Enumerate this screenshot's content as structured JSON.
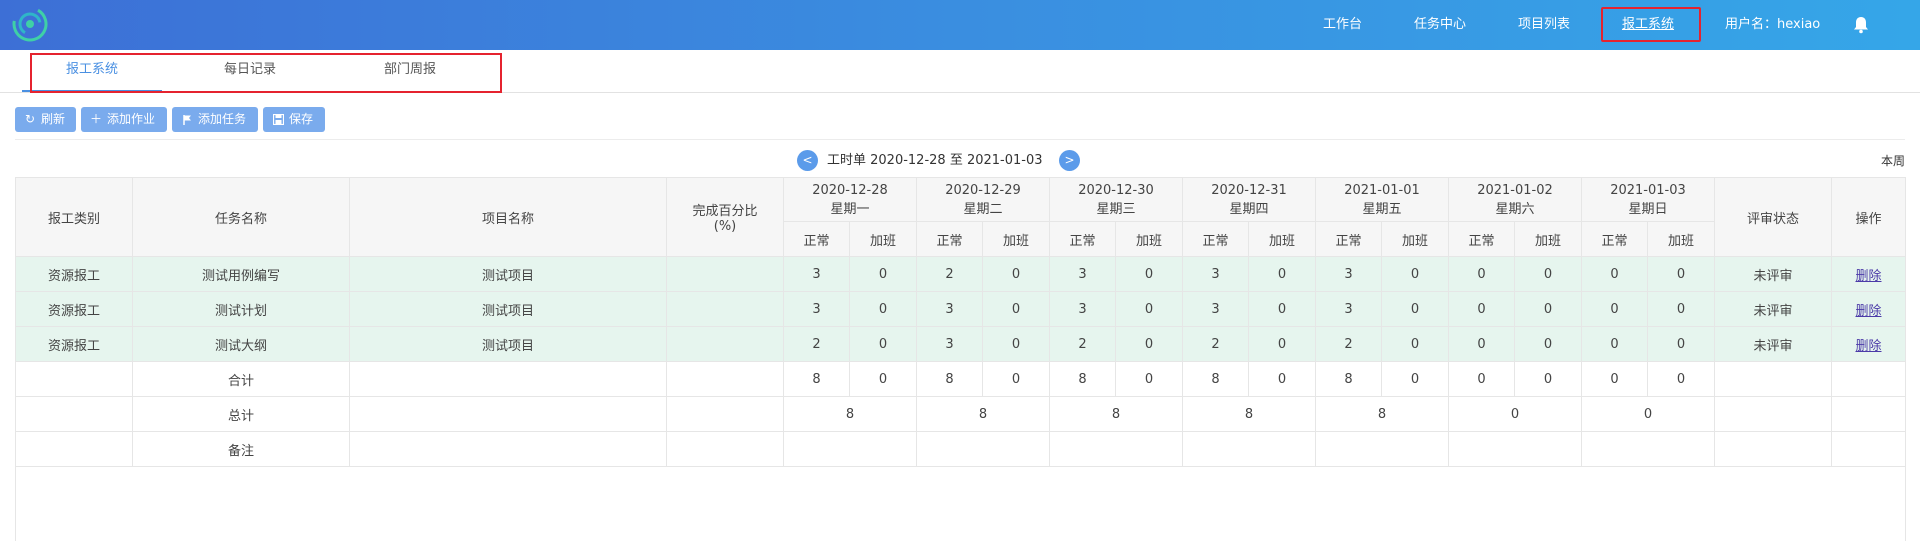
{
  "nav": {
    "items": [
      "工作台",
      "任务中心",
      "项目列表",
      "报工系统"
    ],
    "active_index": 3,
    "user_label": "用户名：hexiao"
  },
  "subtabs": {
    "items": [
      "报工系统",
      "每日记录",
      "部门周报"
    ],
    "active_index": 0
  },
  "toolbar": {
    "refresh": "刷新",
    "add_job": "添加作业",
    "add_task": "添加任务",
    "save": "保存"
  },
  "week": {
    "prev": "<",
    "next": ">",
    "label": "工时单 2020-12-28 至 2021-01-03",
    "this_week": "本周"
  },
  "table": {
    "headers": {
      "category": "报工类别",
      "task": "任务名称",
      "project": "项目名称",
      "percent_line1": "完成百分比",
      "percent_line2": "(%)",
      "status": "评审状态",
      "action": "操作",
      "normal": "正常",
      "overtime": "加班"
    },
    "days": [
      {
        "date": "2020-12-28",
        "weekday": "星期一"
      },
      {
        "date": "2020-12-29",
        "weekday": "星期二"
      },
      {
        "date": "2020-12-30",
        "weekday": "星期三"
      },
      {
        "date": "2020-12-31",
        "weekday": "星期四"
      },
      {
        "date": "2021-01-01",
        "weekday": "星期五"
      },
      {
        "date": "2021-01-02",
        "weekday": "星期六"
      },
      {
        "date": "2021-01-03",
        "weekday": "星期日"
      }
    ],
    "rows": [
      {
        "category": "资源报工",
        "task": "测试用例编写",
        "project": "测试项目",
        "percent": "",
        "hours": [
          "3",
          "0",
          "2",
          "0",
          "3",
          "0",
          "3",
          "0",
          "3",
          "0",
          "0",
          "0",
          "0",
          "0"
        ],
        "status": "未评审",
        "action": "删除"
      },
      {
        "category": "资源报工",
        "task": "测试计划",
        "project": "测试项目",
        "percent": "",
        "hours": [
          "3",
          "0",
          "3",
          "0",
          "3",
          "0",
          "3",
          "0",
          "3",
          "0",
          "0",
          "0",
          "0",
          "0"
        ],
        "status": "未评审",
        "action": "删除"
      },
      {
        "category": "资源报工",
        "task": "测试大纲",
        "project": "测试项目",
        "percent": "",
        "hours": [
          "2",
          "0",
          "3",
          "0",
          "2",
          "0",
          "2",
          "0",
          "2",
          "0",
          "0",
          "0",
          "0",
          "0"
        ],
        "status": "未评审",
        "action": "删除"
      }
    ],
    "subtotal": {
      "label": "合计",
      "hours": [
        "8",
        "0",
        "8",
        "0",
        "8",
        "0",
        "8",
        "0",
        "8",
        "0",
        "0",
        "0",
        "0",
        "0"
      ]
    },
    "total": {
      "label": "总计",
      "days": [
        "8",
        "8",
        "8",
        "8",
        "8",
        "0",
        "0"
      ]
    },
    "remark": {
      "label": "备注"
    }
  },
  "colors": {
    "header_gradient_start": "#3d6fd6",
    "header_gradient_end": "#35a6e8",
    "highlight_box": "#e5232f",
    "button_bg": "#7aabed",
    "row_highlight": "#e6f5ee",
    "active_tab": "#4a90e2"
  }
}
